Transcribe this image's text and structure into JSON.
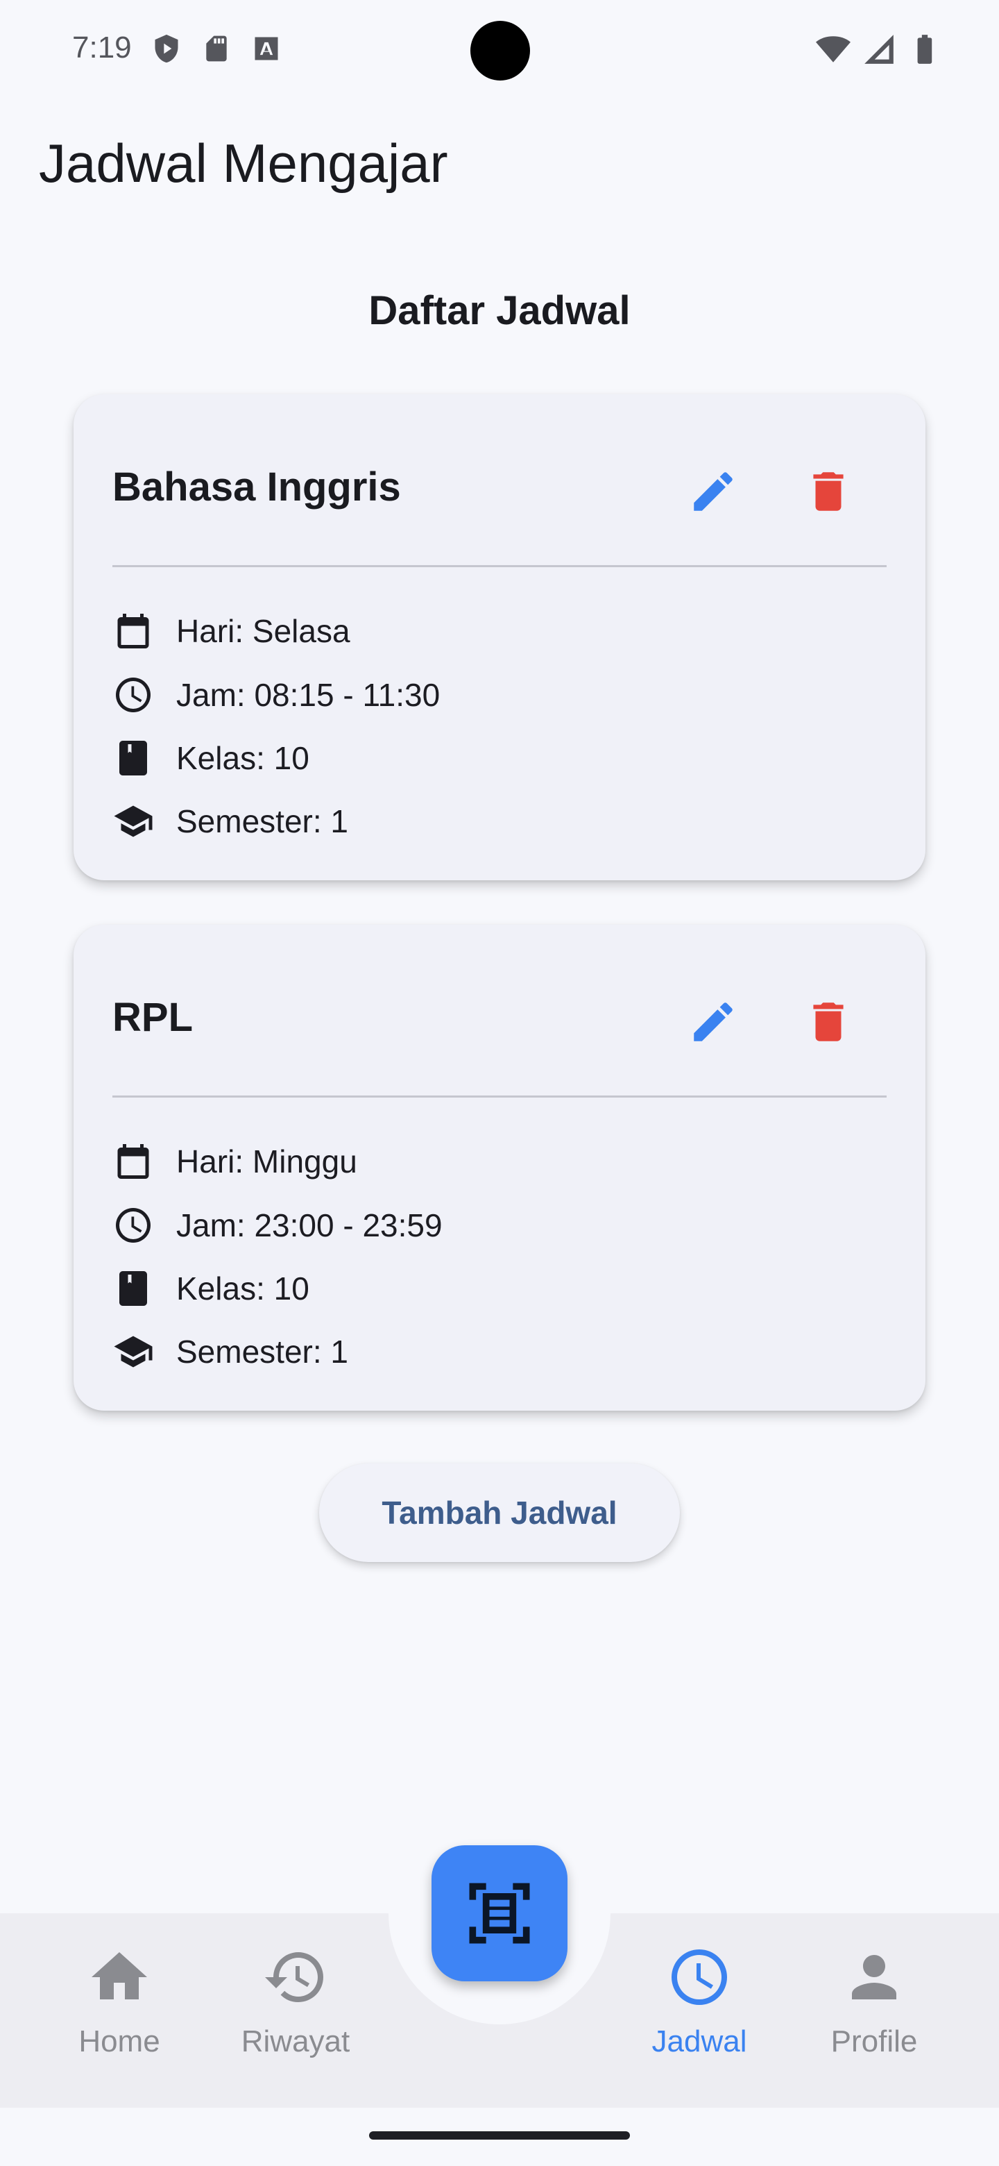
{
  "status_bar": {
    "time": "7:19"
  },
  "app_bar": {
    "title": "Jadwal Mengajar"
  },
  "section_title": "Daftar Jadwal",
  "schedules": [
    {
      "subject": "Bahasa Inggris",
      "hari": "Hari: Selasa",
      "jam": "Jam: 08:15 - 11:30",
      "kelas": "Kelas: 10",
      "semester": "Semester: 1"
    },
    {
      "subject": "RPL",
      "hari": "Hari: Minggu",
      "jam": "Jam: 23:00 - 23:59",
      "kelas": "Kelas: 10",
      "semester": "Semester: 1"
    }
  ],
  "add_button": {
    "label": "Tambah Jadwal"
  },
  "bottom_nav": {
    "items": [
      {
        "label": "Home",
        "icon": "home-icon",
        "active": false
      },
      {
        "label": "Riwayat",
        "icon": "history-icon",
        "active": false
      },
      {
        "label": "Jadwal",
        "icon": "clock-icon",
        "active": true
      },
      {
        "label": "Profile",
        "icon": "person-icon",
        "active": false
      }
    ],
    "fab_icon": "document-scanner-icon"
  },
  "colors": {
    "accent": "#3e84f5",
    "delete": "#e5453b",
    "edit": "#3a82f0",
    "inactive_nav": "#8a8b90",
    "button_text": "#3e5d8c"
  }
}
